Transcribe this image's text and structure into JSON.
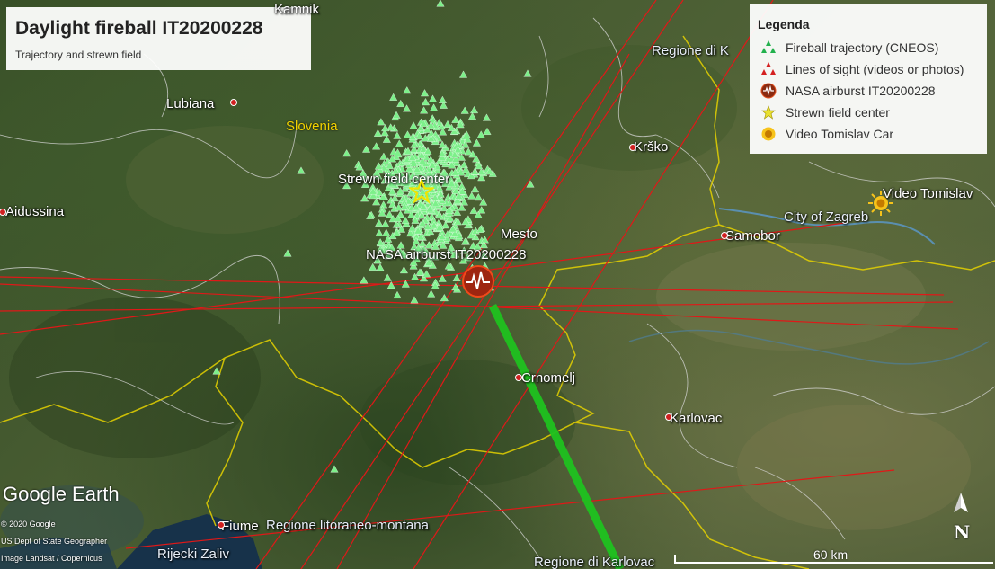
{
  "title": {
    "heading": "Daylight fireball IT20200228",
    "subheading": "Trajectory and strewn field"
  },
  "legend": {
    "title": "Legenda",
    "items": [
      {
        "label": "Fireball trajectory (CNEOS)",
        "icon": "green-triangles-icon",
        "color": "#22b14c"
      },
      {
        "label": "Lines of sight (videos or photos)",
        "icon": "red-triangles-icon",
        "color": "#d42020"
      },
      {
        "label": "NASA airburst IT20200228",
        "icon": "airburst-icon",
        "color": "#b83a1a"
      },
      {
        "label": "Strewn field center",
        "icon": "star-icon",
        "color": "#e8e030"
      },
      {
        "label": "Video Tomislav Car",
        "icon": "sun-icon",
        "color": "#f2b500"
      }
    ]
  },
  "markers": {
    "strewn_center": "Strewn field center",
    "airburst": "NASA airburst IT20200228",
    "video": "Video Tomislav"
  },
  "places": {
    "kamnik": "Kamnik",
    "lubiana": "Lubiana",
    "aidussina": "Aidussina",
    "krsko": "Krško",
    "samobor": "Samobor",
    "zagreb": "City of Zagreb",
    "mesto": "Mesto",
    "crnomelj": "Crnomelj",
    "karlovac": "Karlovac",
    "fiume": "Fiume",
    "rijecki": "Rijecki Zaliv"
  },
  "regions": {
    "slovenia": "Slovenia",
    "krapina": "Regione di K",
    "litoraneo": "Regione litoraneo-montana",
    "karlovac_region": "Regione di Karlovac"
  },
  "branding": {
    "logo": "Google Earth",
    "credit1": "© 2020 Google",
    "credit2": "US Dept of State Geographer",
    "credit3": "Image Landsat / Copernicus"
  },
  "scale": {
    "label": "60 km"
  },
  "compass": {
    "label": "N"
  },
  "colors": {
    "trajectory": "#1fc21f",
    "sightline": "#e01818",
    "triangle": "#7df08a",
    "border_yellow": "#e6d200",
    "border_white": "#d8d8d8"
  }
}
